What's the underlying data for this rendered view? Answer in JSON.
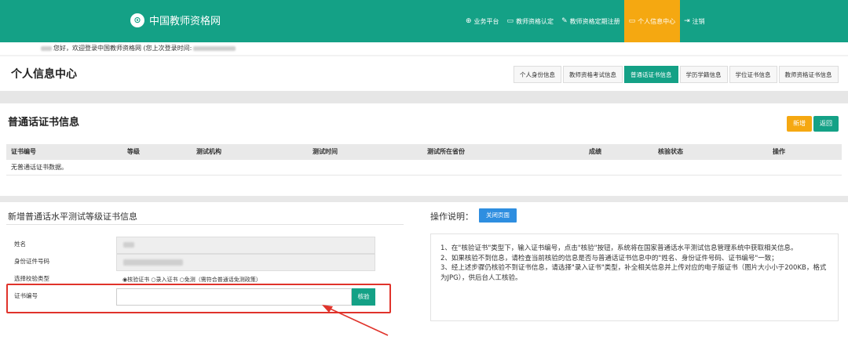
{
  "header": {
    "site_name": "中国教师资格网",
    "nav": [
      {
        "icon": "globe-icon",
        "label": "业务平台"
      },
      {
        "icon": "monitor-icon",
        "label": "教师资格认定"
      },
      {
        "icon": "edit-icon",
        "label": "教师资格定期注册"
      },
      {
        "icon": "monitor-icon",
        "label": "个人信息中心",
        "active": true
      },
      {
        "icon": "logout-icon",
        "label": "注销"
      }
    ],
    "active_color": "#f5a811",
    "brand_color": "#14a186"
  },
  "welcome": {
    "text": "您好，欢迎登录中国教师资格网 (您上次登录时间:"
  },
  "personal_center": {
    "title": "个人信息中心",
    "tabs": [
      {
        "label": "个人身份信息"
      },
      {
        "label": "教师资格考试信息"
      },
      {
        "label": "普通话证书信息",
        "active": true
      },
      {
        "label": "学历学籍信息"
      },
      {
        "label": "学位证书信息"
      },
      {
        "label": "教师资格证书信息"
      }
    ]
  },
  "cert_panel": {
    "title": "普通话证书信息",
    "add_label": "新增",
    "back_label": "返回",
    "columns": [
      "证书编号",
      "等级",
      "测试机构",
      "测试时间",
      "测试所在省份",
      "成绩",
      "核验状态",
      "操作"
    ],
    "empty_text": "无普通话证书数据。"
  },
  "add_form": {
    "title": "新增普通话水平测试等级证书信息",
    "fields": {
      "name_label": "姓名",
      "id_label": "身份证件号码",
      "type_label": "选择校验类型",
      "cert_label": "证书编号"
    },
    "radio_text": "◉核验证书 ○录入证书 ○免测（需符合普通话免测政策）",
    "verify_label": "核验"
  },
  "instructions": {
    "title": "操作说明：",
    "close_label": "关闭页面",
    "lines": [
      "1、在\"核验证书\"类型下，输入证书编号，点击\"核验\"按钮，系统将在国家普通话水平测试信息管理系统中获取相关信息。",
      "2、如果核验不到信息，请检查当前核验的信息是否与普通话证书信息中的\"姓名、身份证件号码、证书编号\"一致；",
      "3、经上述步骤仍核验不到证书信息，请选择\"录入证书\"类型，补全相关信息并上传对应的电子版证书（图片大小小于200KB，格式为JPG），供后台人工核验。"
    ]
  }
}
